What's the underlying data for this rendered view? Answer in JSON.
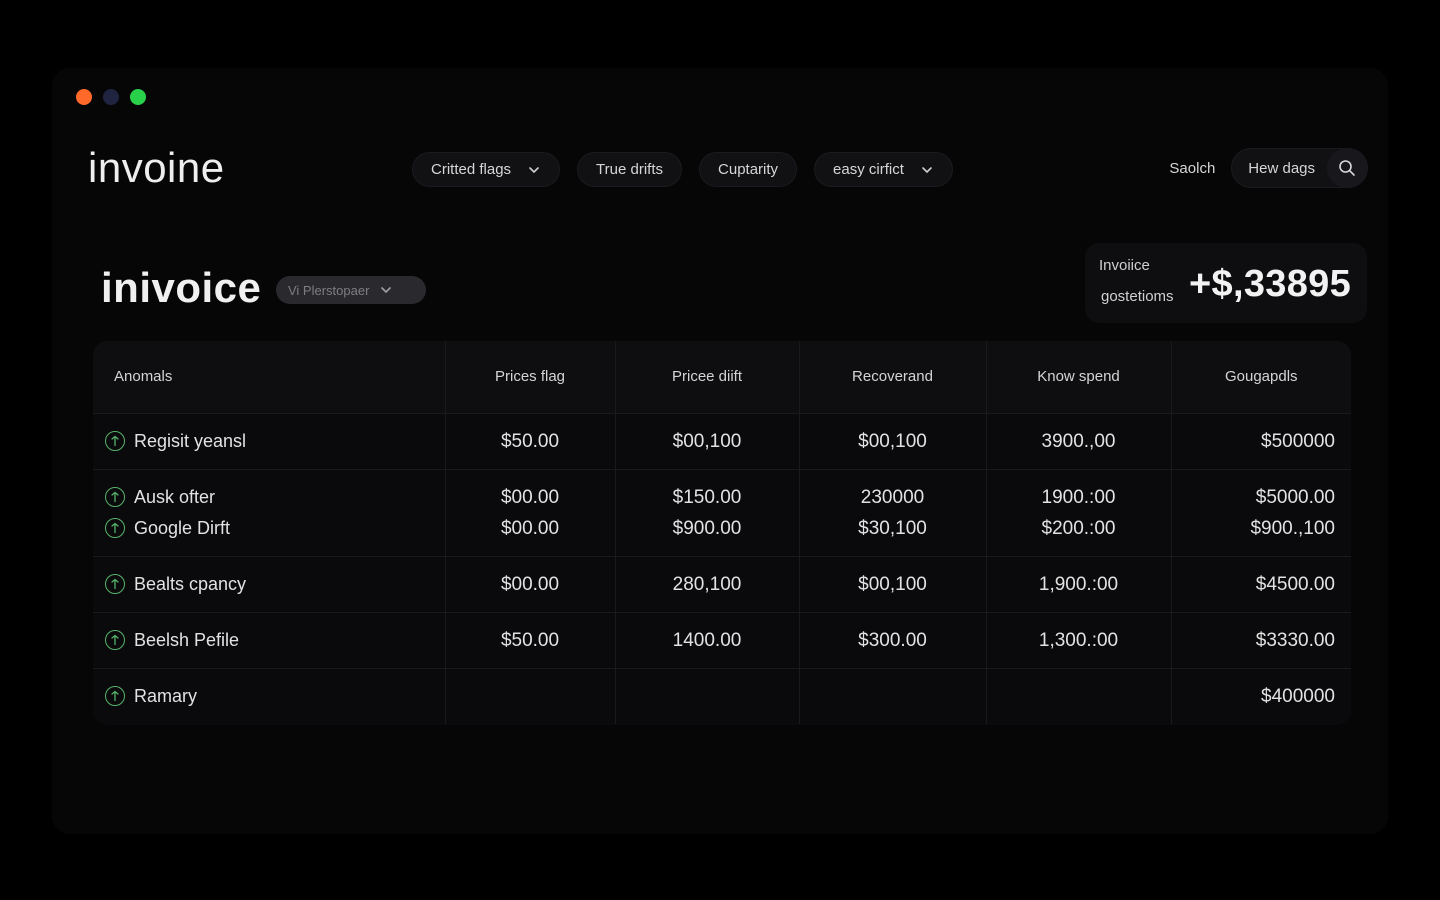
{
  "window": {
    "traffic_colors": [
      "#ff6a2b",
      "#1f2440",
      "#29d14a"
    ]
  },
  "header": {
    "brand": "invoine",
    "filters": [
      {
        "label": "Critted flags",
        "has_dropdown": true
      },
      {
        "label": "True drifts",
        "has_dropdown": false
      },
      {
        "label": "Cuptarity",
        "has_dropdown": false
      },
      {
        "label": "easy cirfict",
        "has_dropdown": true
      }
    ],
    "search_label": "Saolch",
    "how_label": "Hew dags",
    "search_icon": "search-icon"
  },
  "main": {
    "title": "inivoice",
    "selector_value": "Vi Plerstopaer"
  },
  "summary": {
    "label_top": "Invoiice",
    "label_bottom": "gostetioms",
    "value": "+$,33895"
  },
  "table": {
    "accent": "#56b36a",
    "headers": [
      "Anomals",
      "Prices flag",
      "Pricee diift",
      "Recoverand",
      "Know spend",
      "Gougapdls"
    ],
    "rows": [
      {
        "names": [
          "Regisit yeansl"
        ],
        "cols": [
          [
            "$50.00"
          ],
          [
            "$00,100"
          ],
          [
            "$00,100"
          ],
          [
            "3900.,00"
          ],
          [
            "$500000"
          ]
        ]
      },
      {
        "names": [
          "Ausk ofter",
          "Google Dirft"
        ],
        "cols": [
          [
            "$00.00",
            "$00.00"
          ],
          [
            "$150.00",
            "$900.00"
          ],
          [
            "230000",
            "$30,100"
          ],
          [
            "1900.:00",
            "$200.:00"
          ],
          [
            "$5000.00",
            "$900.,100"
          ]
        ]
      },
      {
        "names": [
          "Bealts cpancy"
        ],
        "cols": [
          [
            "$00.00"
          ],
          [
            "280,100"
          ],
          [
            "$00,100"
          ],
          [
            "1,900.:00"
          ],
          [
            "$4500.00"
          ]
        ]
      },
      {
        "names": [
          "Beelsh Pefile"
        ],
        "cols": [
          [
            "$50.00"
          ],
          [
            "1400.00"
          ],
          [
            "$300.00"
          ],
          [
            "1,300.:00"
          ],
          [
            "$3330.00"
          ]
        ]
      },
      {
        "names": [
          "Ramary"
        ],
        "cols": [
          [
            ""
          ],
          [
            ""
          ],
          [
            ""
          ],
          [
            ""
          ],
          [
            "$400000"
          ]
        ]
      }
    ]
  }
}
